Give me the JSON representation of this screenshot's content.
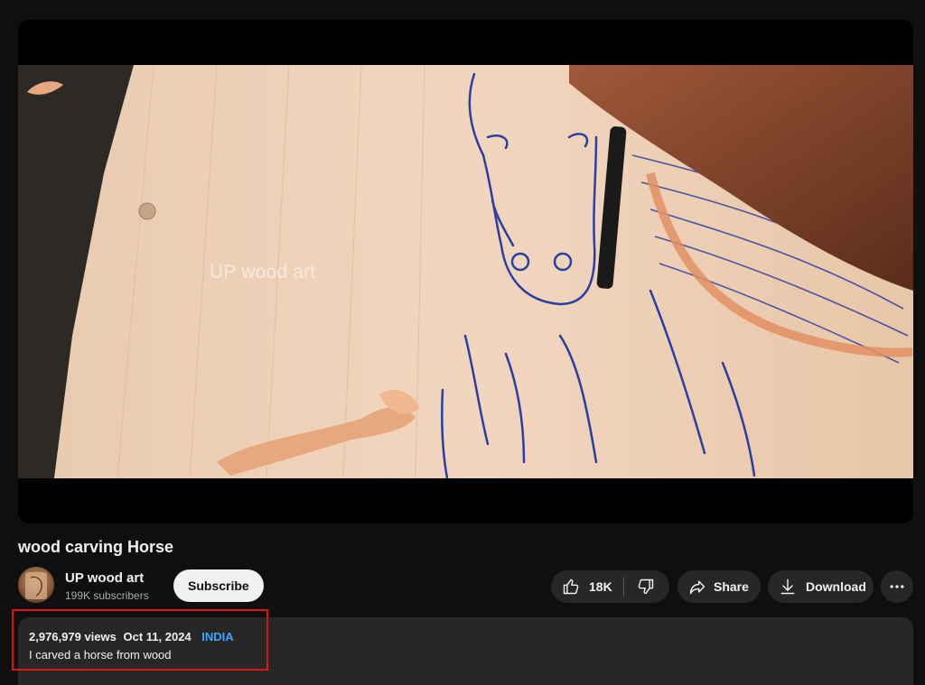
{
  "video": {
    "title": "wood carving Horse",
    "watermark": "UP wood art"
  },
  "channel": {
    "name": "UP wood art",
    "subscribers": "199K subscribers",
    "subscribe_label": "Subscribe"
  },
  "actions": {
    "like_count": "18K",
    "share_label": "Share",
    "download_label": "Download"
  },
  "description": {
    "views": "2,976,979 views",
    "date": "Oct 11, 2024",
    "hashtag": "INDIA",
    "text": "I carved a horse from wood"
  },
  "colors": {
    "highlight_border": "#e01414",
    "hashtag": "#3ea6ff",
    "background": "#0f0f0f",
    "button_bg": "#272727"
  }
}
